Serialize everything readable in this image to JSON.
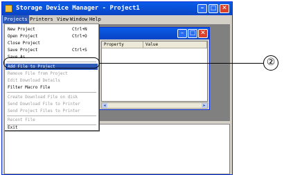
{
  "window": {
    "title": "Storage Device Manager - Project1"
  },
  "menubar": {
    "items": [
      {
        "label": "Projects",
        "active": true
      },
      {
        "label": "Printers"
      },
      {
        "label": "View"
      },
      {
        "label": "Window"
      },
      {
        "label": "Help"
      }
    ]
  },
  "child_window": {
    "columns": [
      "Property",
      "Value"
    ]
  },
  "dropdown": {
    "items": [
      {
        "label": "New Project",
        "shortcut": "Ctrl+N"
      },
      {
        "label": "Open Project",
        "shortcut": "Ctrl+O"
      },
      {
        "label": "Close Project"
      },
      {
        "label": "Save Project",
        "shortcut": "Ctrl+S"
      },
      {
        "label": "Save As ..."
      },
      {
        "label": "Add File to Project",
        "highlighted": true
      },
      {
        "label": "Remove File from Project",
        "disabled": true
      },
      {
        "label": "Edit Download Details",
        "disabled": true
      },
      {
        "label": "Filter Macro File"
      },
      {
        "label": "Create Download File on disk",
        "disabled": true
      },
      {
        "label": "Send Download File to Printer",
        "disabled": true
      },
      {
        "label": "Send Project Files to Printer",
        "disabled": true
      },
      {
        "label": "Recent File",
        "disabled": true
      },
      {
        "label": "Exit"
      }
    ]
  },
  "callout": {
    "number": "②"
  },
  "colors": {
    "titlebar": "#0a5ce8",
    "highlight": "#2d59b8",
    "client": "#808080"
  }
}
